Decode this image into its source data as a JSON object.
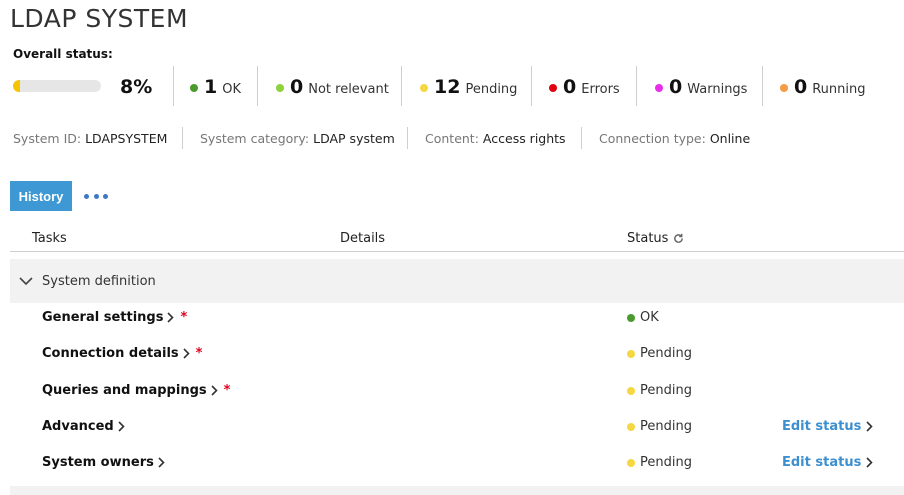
{
  "page": {
    "title": "LDAP SYSTEM"
  },
  "overall": {
    "label": "Overall status:",
    "progress_fraction": 0.08,
    "progress_text": "8%",
    "stats": [
      {
        "count": "1",
        "label": "OK",
        "color": "#4a9a2e"
      },
      {
        "count": "0",
        "label": "Not relevant",
        "color": "#8fd13a"
      },
      {
        "count": "12",
        "label": "Pending",
        "color": "#f5d742"
      },
      {
        "count": "0",
        "label": "Errors",
        "color": "#e3000f"
      },
      {
        "count": "0",
        "label": "Warnings",
        "color": "#e82ee8"
      },
      {
        "count": "0",
        "label": "Running",
        "color": "#f59a45"
      }
    ]
  },
  "meta": [
    {
      "key": "System ID:",
      "value": "LDAPSYSTEM"
    },
    {
      "key": "System category:",
      "value": "LDAP system"
    },
    {
      "key": "Content:",
      "value": "Access rights"
    },
    {
      "key": "Connection type:",
      "value": "Online"
    }
  ],
  "toolbar": {
    "history_label": "History",
    "more_icon": "ellipsis-icon"
  },
  "table": {
    "headers": {
      "tasks": "Tasks",
      "details": "Details",
      "status": "Status",
      "status_icon": "refresh-icon"
    },
    "section": {
      "label": "System definition",
      "icon": "chevron-down-icon"
    },
    "rows": [
      {
        "name": "General settings",
        "required": "*",
        "status": "OK",
        "status_color": "#4a9a2e",
        "edit": ""
      },
      {
        "name": "Connection details",
        "required": "*",
        "status": "Pending",
        "status_color": "#f5d742",
        "edit": ""
      },
      {
        "name": "Queries and mappings",
        "required": "*",
        "status": "Pending",
        "status_color": "#f5d742",
        "edit": ""
      },
      {
        "name": "Advanced",
        "required": "",
        "status": "Pending",
        "status_color": "#f5d742",
        "edit": "Edit status"
      },
      {
        "name": "System owners",
        "required": "",
        "status": "Pending",
        "status_color": "#f5d742",
        "edit": "Edit status"
      }
    ]
  }
}
